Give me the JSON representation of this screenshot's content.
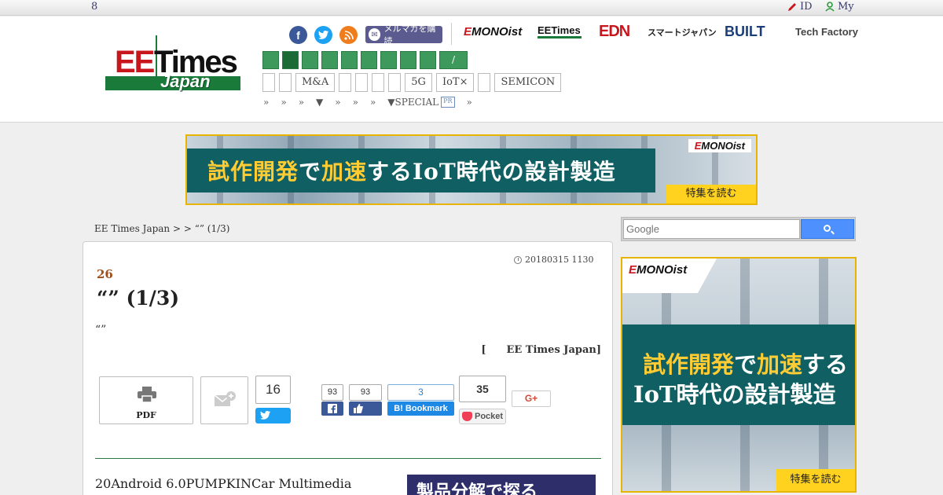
{
  "topbar": {
    "count": "8",
    "id_label": "ID",
    "my_label": "My"
  },
  "header": {
    "logo": {
      "ee": "EE",
      "times": "Times",
      "japan": "Japan"
    },
    "social": {
      "facebook": "f",
      "twitter": "t",
      "rss": "r"
    },
    "mailmag_label": "メルマガを購読",
    "partners": {
      "mono_prefix": "E",
      "mono": "MONOist",
      "eetimes": "EETimes",
      "edn": "EDN",
      "smartjapan": "スマートジャパン",
      "built": "BUILT",
      "techfactory": "Tech Factory"
    },
    "gnav_slash": "/",
    "tags": [
      "",
      "",
      "M&A",
      "",
      "",
      "",
      "",
      "5G",
      "IoT×",
      "",
      "SEMICON"
    ],
    "subnav": [
      "»",
      "»",
      "»",
      "▼",
      "»",
      "»",
      "»",
      "▼SPECIAL",
      "»"
    ],
    "subnav_pr": "PR"
  },
  "banner": {
    "line_part1": "試作開発",
    "line_part2": "で",
    "line_part3": "加速",
    "line_part4": "するIoT時代の設計製造",
    "mono_prefix": "E",
    "mono": "MONOist",
    "cta": "特集を読む"
  },
  "breadcrumb": "EE Times Japan >  > “” (1/3)",
  "article": {
    "date": "20180315 1130",
    "series": "26",
    "title": "“” (1/3)",
    "lead": "“”",
    "author_bracket": "[",
    "author_name": "EE Times Japan]",
    "pdf_label": "PDF",
    "share": {
      "twitter_count": "16",
      "facebook_count": "93",
      "like_count": "93",
      "hatena_count": "3",
      "hatena_label": "B! Bookmark",
      "pocket_count": "35",
      "pocket_label": "Pocket",
      "gplus_label": "G+"
    },
    "body_first_line": "20Android 6.0PUMPKINCar Multimedia",
    "promo_text": "製品分解で探る"
  },
  "sidebar": {
    "search_placeholder": "Google",
    "ad": {
      "mono_prefix": "E",
      "mono": "MONOist",
      "line1_part1": "試作開発",
      "line1_part2": "で",
      "line1_part3": "加速",
      "line1_part4": "する",
      "line2": "IoT時代の設計製造",
      "cta": "特集を読む"
    }
  },
  "colors": {
    "brand_green": "#1a7a3a",
    "brand_red": "#c8161d",
    "ad_teal": "#0f5f63",
    "ad_yellow": "#ffd21f"
  }
}
